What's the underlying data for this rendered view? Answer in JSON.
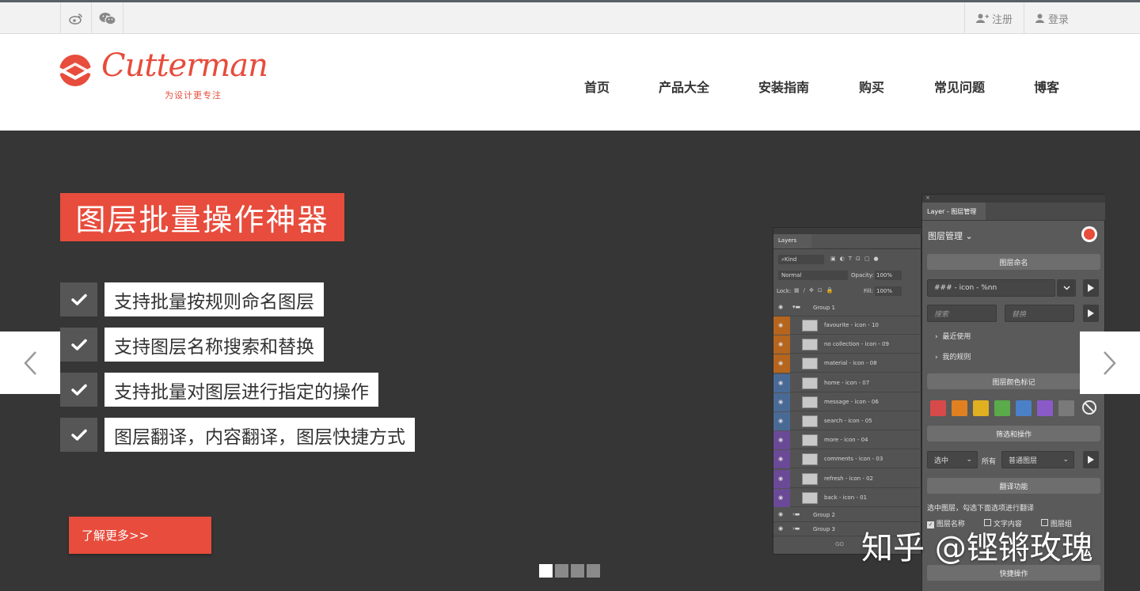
{
  "topbar": {
    "social_icons": [
      "weibo-icon",
      "wechat-icon"
    ],
    "register_label": "注册",
    "login_label": "登录"
  },
  "header": {
    "logo_text": "Cutterman",
    "logo_slogan": "为设计更专注",
    "nav": [
      "首页",
      "产品大全",
      "安装指南",
      "购买",
      "常见问题",
      "博客"
    ]
  },
  "hero": {
    "title": "图层批量操作神器",
    "features": [
      "支持批量按规则命名图层",
      "支持图层名称搜索和替换",
      "支持批量对图层进行指定的操作",
      "图层翻译，内容翻译，图层快捷方式"
    ],
    "more_button": "了解更多>>",
    "slides_count": 4,
    "active_slide": 1
  },
  "screenshot": {
    "layers_panel": {
      "tab": "Layers",
      "kind_label": "Kind",
      "blend_mode": "Normal",
      "opacity_label": "Opacity:",
      "opacity_value": "100%",
      "lock_label": "Lock:",
      "fill_label": "Fill:",
      "fill_value": "100%",
      "group_1": "Group 1",
      "layers": [
        "favourite - icon - 10",
        "no collection - icon - 09",
        "material - icon - 08",
        "home - icon - 07",
        "message - icon - 06",
        "search - icon - 05",
        "more - icon - 04",
        "comments - icon - 03",
        "refresh - icon - 02",
        "back - icon - 01"
      ],
      "layer_strip_colors": [
        "#b5651d",
        "#b5651d",
        "#b5651d",
        "#4a6a96",
        "#4a6a96",
        "#4a6a96",
        "#6a4a96",
        "#6a4a96",
        "#6a4a96",
        "#6a4a96"
      ],
      "group_2": "Group 2",
      "group_3": "Group 3",
      "footer_text": "GO"
    },
    "tool_panel": {
      "tab_title": "Layer - 图层管理",
      "header_title": "图层管理",
      "naming_button": "图层命名",
      "rule_value": "### - icon - %nn",
      "search_placeholder": "搜索",
      "replace_placeholder": "替换",
      "recent_label": "最近使用",
      "my_rules_label": "我的规则",
      "color_mark_button": "图层颜色标记",
      "colors": [
        "#d84a4a",
        "#e08020",
        "#e0b020",
        "#5aab4a",
        "#4a80c8",
        "#8a5ac8",
        "#7a7a7a"
      ],
      "filter_button": "筛选和操作",
      "select_value": "选中",
      "all_label": "所有",
      "layer_type_value": "普通图层",
      "translate_button": "翻译功能",
      "translate_hint": "选中图层，勾选下面选项进行翻译",
      "check_layer_name": "图层名称",
      "check_text_content": "文字内容",
      "check_layer_group": "图层组",
      "shortcut_button": "快捷操作"
    }
  },
  "watermark": "知乎 @铿锵玫瑰",
  "colors": {
    "brand_red": "#e74c3c",
    "hero_bg": "#363636"
  }
}
